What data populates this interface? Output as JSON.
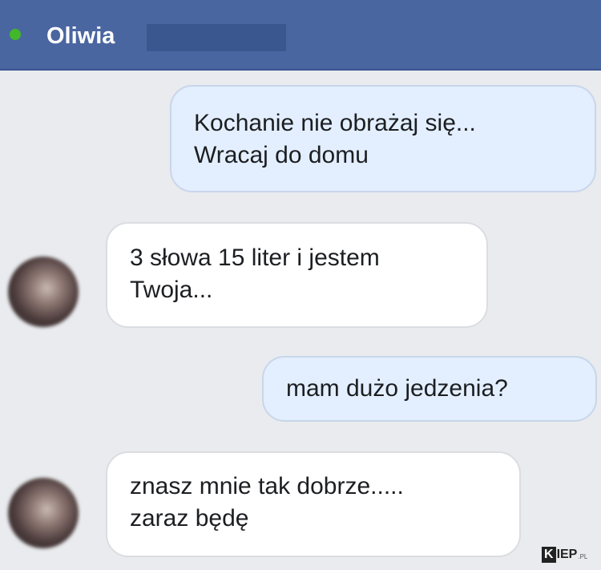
{
  "header": {
    "contact_name": "Oliwia",
    "online_status_color": "#42b72a",
    "background_color": "#4a66a0"
  },
  "messages": [
    {
      "direction": "outgoing",
      "lines": [
        "Kochanie nie obrażaj się...",
        "Wracaj do domu"
      ]
    },
    {
      "direction": "incoming",
      "lines": [
        "3 słowa 15 liter i jestem",
        "Twoja..."
      ]
    },
    {
      "direction": "outgoing",
      "lines": [
        "mam dużo jedzenia?"
      ]
    },
    {
      "direction": "incoming",
      "lines": [
        "znasz mnie tak dobrze.....",
        "zaraz będę"
      ]
    }
  ],
  "watermark": {
    "first_letter": "K",
    "rest": "IEP",
    "suffix": ".PL"
  }
}
